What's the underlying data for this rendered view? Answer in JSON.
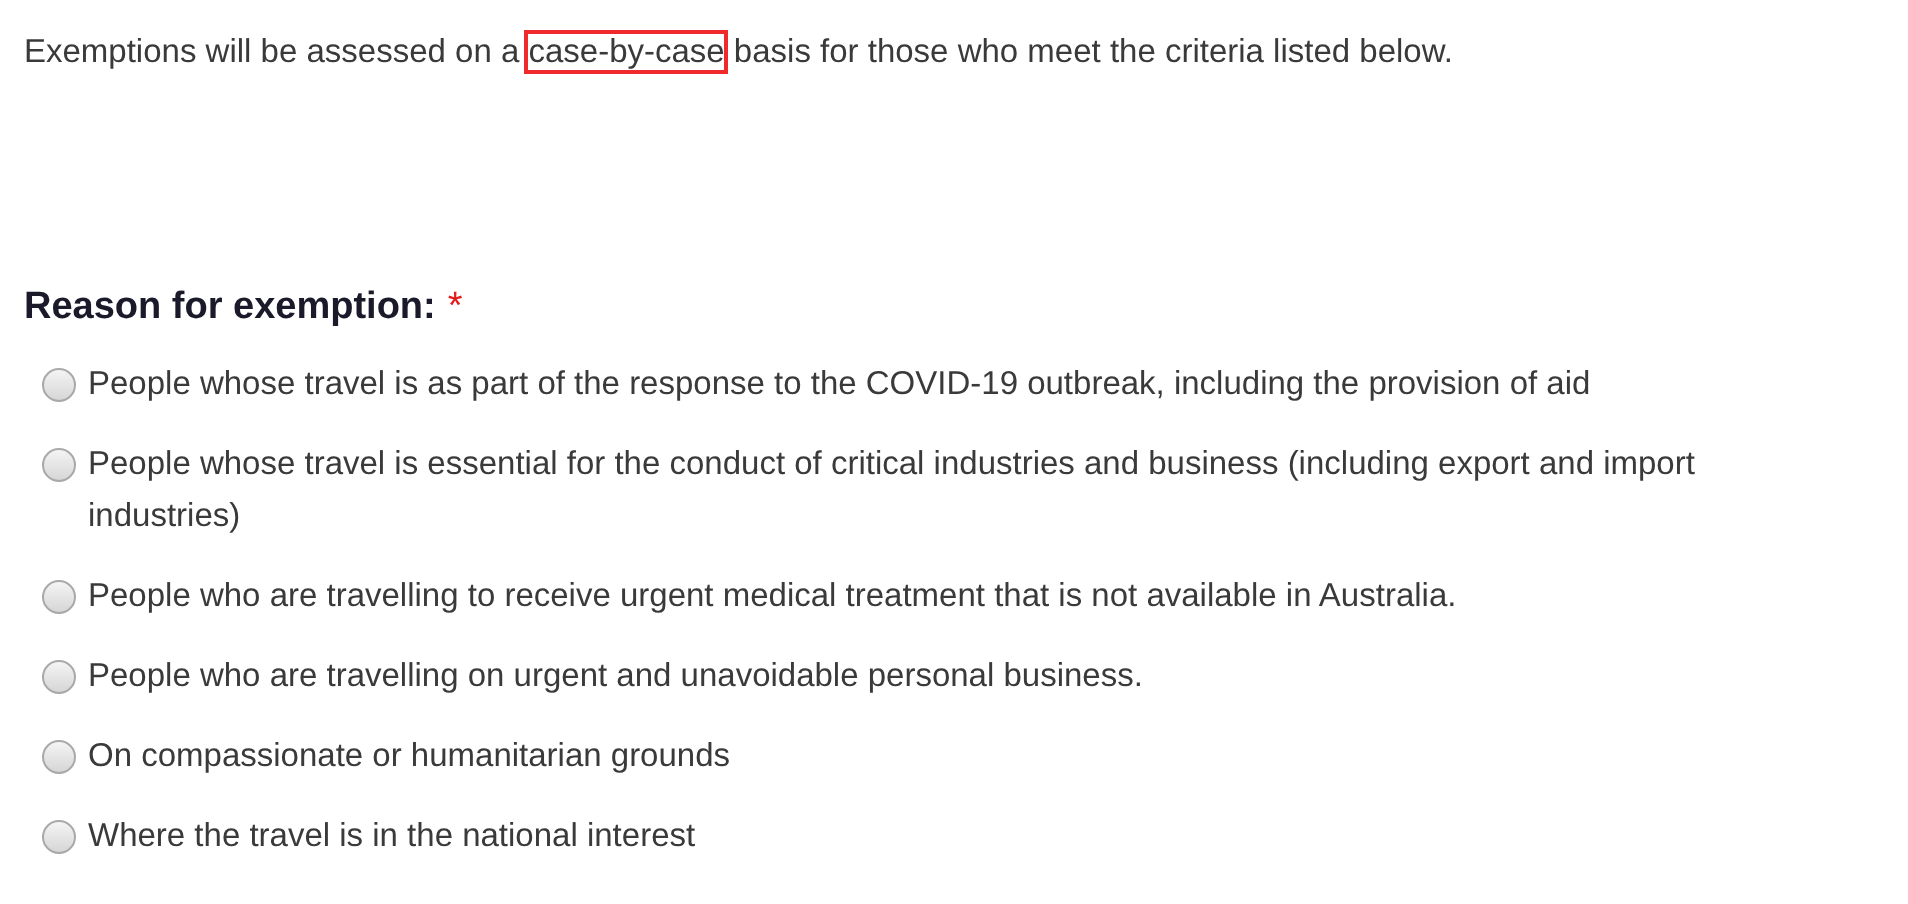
{
  "intro": {
    "before": "Exemptions will be assessed on a ",
    "highlighted": "case-by-case",
    "after": " basis for those who meet the criteria listed below."
  },
  "question": {
    "label": "Reason for exemption:",
    "required_mark": "*"
  },
  "options": [
    {
      "label": "People whose travel is as part of the response to the COVID-19 outbreak, including the provision of aid",
      "selected": false
    },
    {
      "label": "People whose travel is essential for the conduct of critical industries and business (including export and import industries)",
      "selected": false
    },
    {
      "label": "People who are travelling to receive urgent medical treatment that is not available in Australia.",
      "selected": false
    },
    {
      "label": "People who are travelling on urgent and unavoidable personal business.",
      "selected": false
    },
    {
      "label": "On compassionate or humanitarian grounds",
      "selected": false
    },
    {
      "label": "Where the travel is in the national interest",
      "selected": false
    }
  ]
}
